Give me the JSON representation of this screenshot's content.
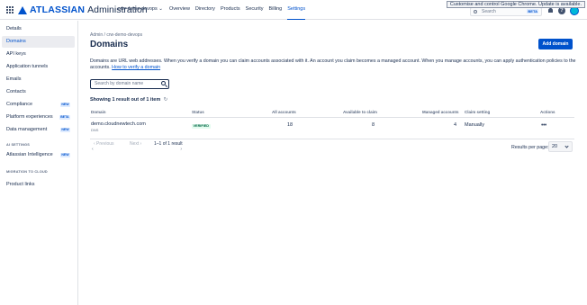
{
  "topbar": {
    "brand": "ATLASSIAN",
    "product": "Administration",
    "org": "crw-demo-devops",
    "nav": [
      "Overview",
      "Directory",
      "Products",
      "Security",
      "Billing",
      "Settings"
    ],
    "active_nav": "Settings",
    "search_placeholder": "Search",
    "search_badge": "BETA",
    "notice": "Customise and control Google Chrome. Update is available."
  },
  "sidebar": {
    "items": [
      {
        "label": "Details"
      },
      {
        "label": "Domains",
        "active": true
      },
      {
        "label": "API keys"
      },
      {
        "label": "Application tunnels"
      },
      {
        "label": "Emails"
      },
      {
        "label": "Contacts"
      },
      {
        "label": "Compliance",
        "badge": "NEW"
      },
      {
        "label": "Platform experiences",
        "badge": "BETA"
      },
      {
        "label": "Data management",
        "badge": "NEW"
      },
      {
        "label": "Atlassian Intelligence",
        "badge": "NEW"
      },
      {
        "label": "Product links"
      }
    ],
    "headings": [
      "AI SETTINGS",
      "MIGRATION TO CLOUD"
    ]
  },
  "main": {
    "breadcrumb": "Admin  /  crw-demo-devops",
    "title": "Domains",
    "add_button": "Add domain",
    "description_text": "Domains are URL web addresses. When you verify a domain you can claim accounts associated with it. An account you claim becomes a managed account. When you manage accounts, you can apply authentication policies to the accounts.",
    "description_link": "How to verify a domain",
    "search_placeholder": "Search by domain name",
    "result_count": "Showing 1 result out of 1 item",
    "refresh_glyph": "↻",
    "table": {
      "headers": [
        "Domain",
        "Status",
        "All accounts",
        "Available to claim",
        "Managed accounts",
        "Claim setting",
        "Actions"
      ],
      "rows": [
        {
          "domain": "demo.cloudnewtech.com",
          "type": "DNS",
          "status": "VERIFIED",
          "all_accounts": "18",
          "available": "8",
          "managed": "4",
          "claim_setting": "Manually",
          "actions": "•••"
        }
      ]
    },
    "pagination": {
      "previous": "‹  Previous",
      "next": "Next  ›",
      "range": "1–1 of 1 result"
    },
    "per_page_label": "Results per page:",
    "per_page_value": "20"
  }
}
